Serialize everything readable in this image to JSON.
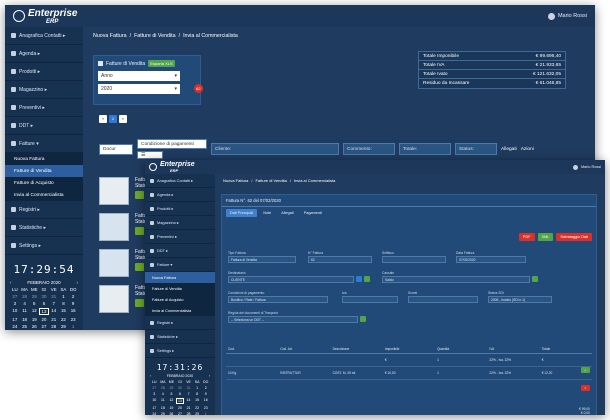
{
  "app": {
    "logo": "Enterprise",
    "logo_sub": "ERP",
    "user": "Mario Rossi"
  },
  "sidebar": {
    "items": [
      {
        "label": "Anagrafica Contatti ▸"
      },
      {
        "label": "Agenda ▸"
      },
      {
        "label": "Prodotti ▸"
      },
      {
        "label": "Magazzino ▸"
      },
      {
        "label": "Preventivi ▸"
      },
      {
        "label": "DDT ▸"
      },
      {
        "label": "Fatture ▾"
      }
    ],
    "submenu": [
      "Nuova Fattura",
      "Fatture di Vendita",
      "Fatture di Acquisto",
      "Invia al Commercialista"
    ],
    "items_after": [
      {
        "label": "Registri ▸"
      },
      {
        "label": "Statistiche ▸"
      },
      {
        "label": "Settings ▸"
      }
    ]
  },
  "clock": {
    "time1": "17:29:54",
    "time2": "17:31:26"
  },
  "calendar": {
    "month": "FEBBRAIO 2020",
    "weekdays": [
      "LU",
      "MA",
      "ME",
      "GI",
      "VE",
      "SA",
      "DO"
    ],
    "days": [
      "27",
      "28",
      "29",
      "30",
      "31",
      "1",
      "2",
      "3",
      "4",
      "5",
      "6",
      "7",
      "8",
      "9",
      "10",
      "11",
      "12",
      "13",
      "14",
      "15",
      "16",
      "17",
      "18",
      "19",
      "20",
      "21",
      "22",
      "23",
      "24",
      "25",
      "26",
      "27",
      "28",
      "29",
      "1"
    ]
  },
  "win1": {
    "breadcrumb": [
      "Nuova Fattura",
      "/",
      "Fatture di Vendita",
      "/",
      "Invia al Commercialista"
    ],
    "panel_title": "Fatture di Vendita",
    "export_btn": "Esporta XLS",
    "year_label": "Anno",
    "year_value": "2020",
    "count_badge": "62",
    "totals": [
      {
        "label": "Totale Imponibile",
        "value": "€ 99.696,40"
      },
      {
        "label": "Totale IVA",
        "value": "€ 21.933,65"
      },
      {
        "label": "Totale Ivato",
        "value": "€ 121.632,05"
      },
      {
        "label": "Residuo da Incassare",
        "value": "€ 61.046,85"
      }
    ],
    "pager": [
      "«",
      "1",
      "»"
    ],
    "filters": {
      "doc": "Docur",
      "conditions": "Condizione di pagamenti",
      "cliente": "Cliente:",
      "commento": "Commento:",
      "totale": "Totale:",
      "status": "Status:",
      "allegati": "Allegati",
      "azioni": "Azioni"
    },
    "rows": [
      {
        "title": "Fattura N",
        "sub": "Stato:"
      },
      {
        "title": "Fattura N",
        "sub": "Stato:"
      },
      {
        "title": "Fattura N",
        "sub": "Stato:"
      },
      {
        "title": "Fattura N",
        "sub": "Stato:"
      }
    ]
  },
  "win2": {
    "breadcrumb": [
      "Nuova Fattura",
      "/",
      "Fatture di Vendita",
      "/",
      "Invia al Commercialista"
    ],
    "panel_title": "Fattura N°. 62 del 07/02/2020",
    "buttons": {
      "pdf": "PDF",
      "xml": "XML",
      "save": "Salvataggio Dati"
    },
    "tabs": [
      "Dati Principali",
      "Note",
      "Allegati",
      "Pagamenti"
    ],
    "fields": [
      {
        "label": "Tipo Fattura",
        "value": "Fattura di Vendita"
      },
      {
        "label": "N° Fattura",
        "value": "62"
      },
      {
        "label": "Suffisso",
        "value": ""
      },
      {
        "label": "Data Fattura",
        "value": "07/02/2020"
      },
      {
        "label": "Destinatario",
        "value": "CLIENTE"
      },
      {
        "label": "Causale",
        "value": "Saldo"
      },
      {
        "label": "Condizioni di pagamento",
        "value": "Bonifico / Rate / Fattura"
      },
      {
        "label": "Iva",
        "value": ""
      },
      {
        "label": "Sconti",
        "value": ""
      },
      {
        "label": "Status SDI",
        "value": "2006 - Inviato (SDI n.1)"
      },
      {
        "label": "Regola dei documenti di Trasporto",
        "value": "-- Seleziona un DDT --"
      }
    ],
    "table_head": [
      "Cod.",
      "Cod. Art.",
      "Descrizione",
      "Imponibile",
      "Quantità",
      "IVA",
      "Totale"
    ],
    "table_rows": [
      {
        "cells": [
          "",
          "",
          "",
          "€",
          "1",
          "22% - Iva. 22%",
          "€"
        ]
      },
      {
        "cells": [
          "10 Kg",
          "RISTRUTTUR",
          "COST. M. 25 mt",
          "€ 10,00",
          "1",
          "22% - Iva. 22%",
          "€ 12,20"
        ]
      }
    ],
    "footer_values": [
      "€ 99,00",
      "€ 0,00"
    ]
  }
}
